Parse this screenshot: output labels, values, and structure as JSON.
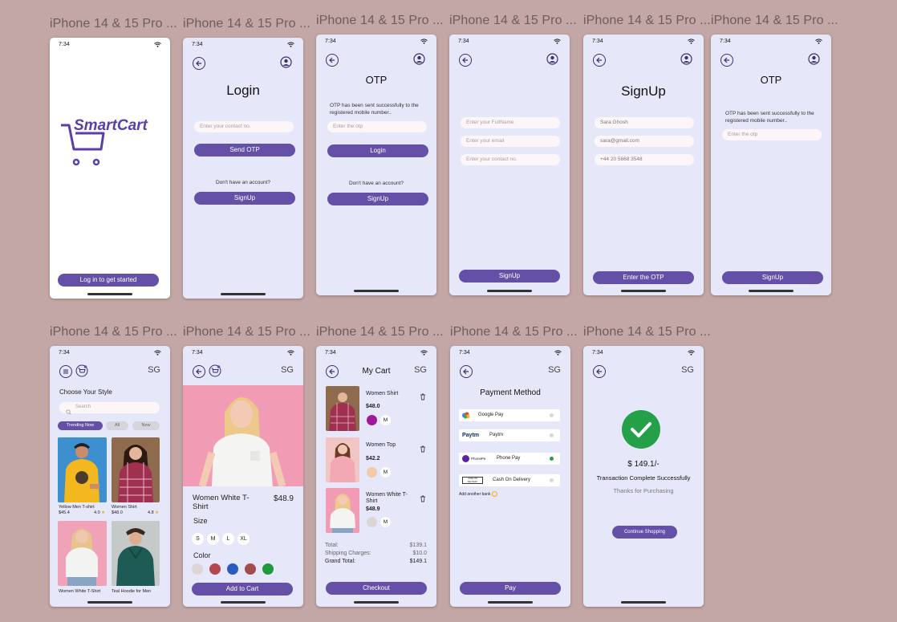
{
  "frames": [
    "iPhone 14 & 15 Pro ...",
    "iPhone 14 & 15 Pro ...",
    "iPhone 14 & 15 Pro ...",
    "iPhone 14 & 15 Pro ...",
    "iPhone 14 & 15 Pro ...",
    "iPhone 14 & 15 Pro ...",
    "iPhone 14 & 15 Pro ...",
    "iPhone 14 & 15 Pro ...",
    "iPhone 14 & 15 Pro ...",
    "iPhone 14 & 15 Pro ...",
    "iPhone 14 & 15 Pro ..."
  ],
  "status_time": "7:34",
  "colors": {
    "canvas": "#c3a6a6",
    "screen": "#e6e8fa",
    "primary": "#6450a7",
    "success": "#24a148"
  },
  "splash": {
    "logo": "SmartCart",
    "button": "Log in to get started"
  },
  "login": {
    "title": "Login",
    "contact_placeholder": "Enter your contact no.",
    "send_otp": "Send OTP",
    "no_account": "Don't have an account?",
    "signup": "SignUp"
  },
  "otp1": {
    "title": "OTP",
    "message": "OTP has been sent successfully to the registered mobile number..",
    "otp_placeholder": "Enter the otp",
    "login": "Login",
    "no_account": "Don't have an account?",
    "signup": "SignUp"
  },
  "signup_form": {
    "fullname": "Enter your FullName",
    "email": "Enter your email",
    "contact": "Enter your contact no.",
    "button": "SignUp"
  },
  "signup_filled": {
    "title": "SignUp",
    "name": "Sara Ghosh",
    "email": "sara@gmail.com",
    "phone": "+44 20 5668 3548",
    "button": "Enter the OTP"
  },
  "otp2": {
    "title": "OTP",
    "message": "OTP has been sent successfully to the registered mobile number..",
    "otp_placeholder": "Enter the otp",
    "button": "SignUp"
  },
  "user_initials": "SG",
  "home": {
    "heading": "Choose Your Style",
    "search_placeholder": "Search",
    "chips": [
      "Trending Now",
      "All",
      "New"
    ],
    "products": [
      {
        "name": "Yellow Men T-shirt",
        "price": "$45.4",
        "rating": "4.0"
      },
      {
        "name": "Women Shirt",
        "price": "$48.0",
        "rating": "4.8"
      },
      {
        "name": "Women White T-Shirt",
        "price": "",
        "rating": ""
      },
      {
        "name": "Teal Hoodie for Men",
        "price": "",
        "rating": ""
      }
    ]
  },
  "detail": {
    "name": "Women White T-Shirt",
    "price": "$48.9",
    "size_label": "Size",
    "sizes": [
      "S",
      "M",
      "L",
      "XL"
    ],
    "color_label": "Color",
    "colors": [
      "#dcd5d5",
      "#b6464d",
      "#2a5bbf",
      "#a34c4c",
      "#1f9a3a"
    ],
    "button": "Add to Cart"
  },
  "cart": {
    "title": "My Cart",
    "items": [
      {
        "name": "Women Shirt",
        "price": "$48.0",
        "size": "M",
        "color": "#a0189b"
      },
      {
        "name": "Women Top",
        "price": "$42.2",
        "size": "M",
        "color": "#f3c9a8"
      },
      {
        "name": "Women White T-Shirt",
        "price": "$48.9",
        "size": "M",
        "color": "#dcd5d5"
      }
    ],
    "total_label": "Total:",
    "total": "$139.1",
    "shipping_label": "Shipping Charges:",
    "shipping": "$10.0",
    "grand_label": "Grand Total:",
    "grand": "$149.1",
    "checkout": "Checkout"
  },
  "payment": {
    "title": "Payment Method",
    "methods": [
      "Google Pay",
      "Paytm",
      "Phone Pay",
      "Cash On Delivery"
    ],
    "selected_index": 2,
    "paytm_logo": "Paytm",
    "phonepe_logo": "PhonePe",
    "cod_logo": "CASH ON DELIVERY",
    "add_bank": "Add another bank",
    "pay": "Pay"
  },
  "success": {
    "amount": "$ 149.1/-",
    "message": "Transaction Complete Successfully",
    "thanks": "Thanks for Purchasing",
    "button": "Continue Shopping"
  }
}
